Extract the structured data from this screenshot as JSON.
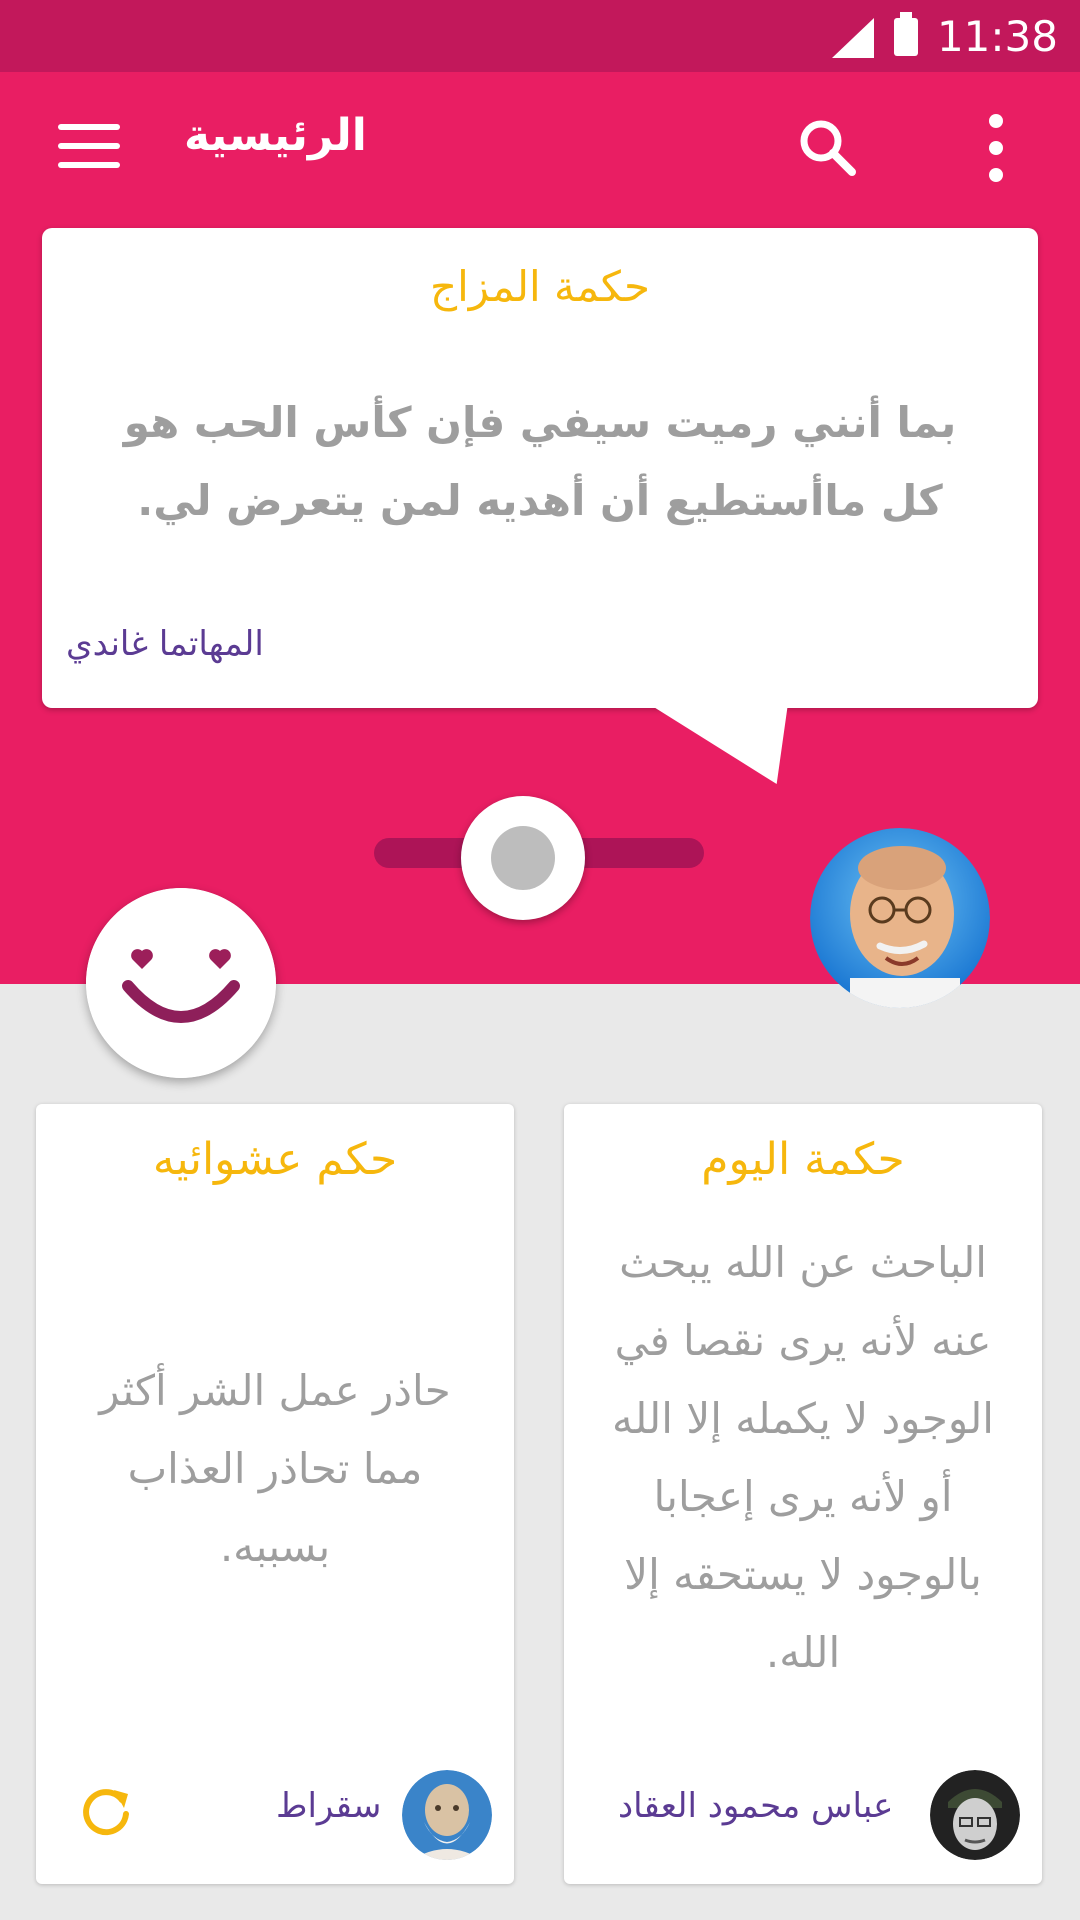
{
  "status_bar": {
    "time": "11:38"
  },
  "toolbar": {
    "title": "الرئيسية"
  },
  "mood_card": {
    "title": "حكمة المزاج",
    "quote": "بما أنني رميت سيفي فإن كأس الحب هو كل ماأستطيع أن أهديه لمن يتعرض لي.",
    "author": "المهاتما غاندي"
  },
  "mood_slider": {
    "level": 0.45
  },
  "cards": {
    "random": {
      "title": "حكم عشوائيه",
      "quote": "حاذر عمل الشر أكثر مما تحاذر العذاب بسببه.",
      "author": "سقراط"
    },
    "daily": {
      "title": "حكمة اليوم",
      "quote": "الباحث عن الله يبحث عنه لأنه يرى نقصا في الوجود لا يكمله إلا الله أو لأنه يرى إعجابا بالوجود لا يستحقه إلا الله.",
      "author": "عباس محمود العقاد"
    }
  },
  "colors": {
    "primary": "#e91e63",
    "primary_dark": "#c2185b",
    "accent": "#f6b70d",
    "author_text": "#5b3b93"
  },
  "icons": [
    "menu-icon",
    "search-icon",
    "more-vert-icon",
    "smile-icon",
    "refresh-icon"
  ]
}
